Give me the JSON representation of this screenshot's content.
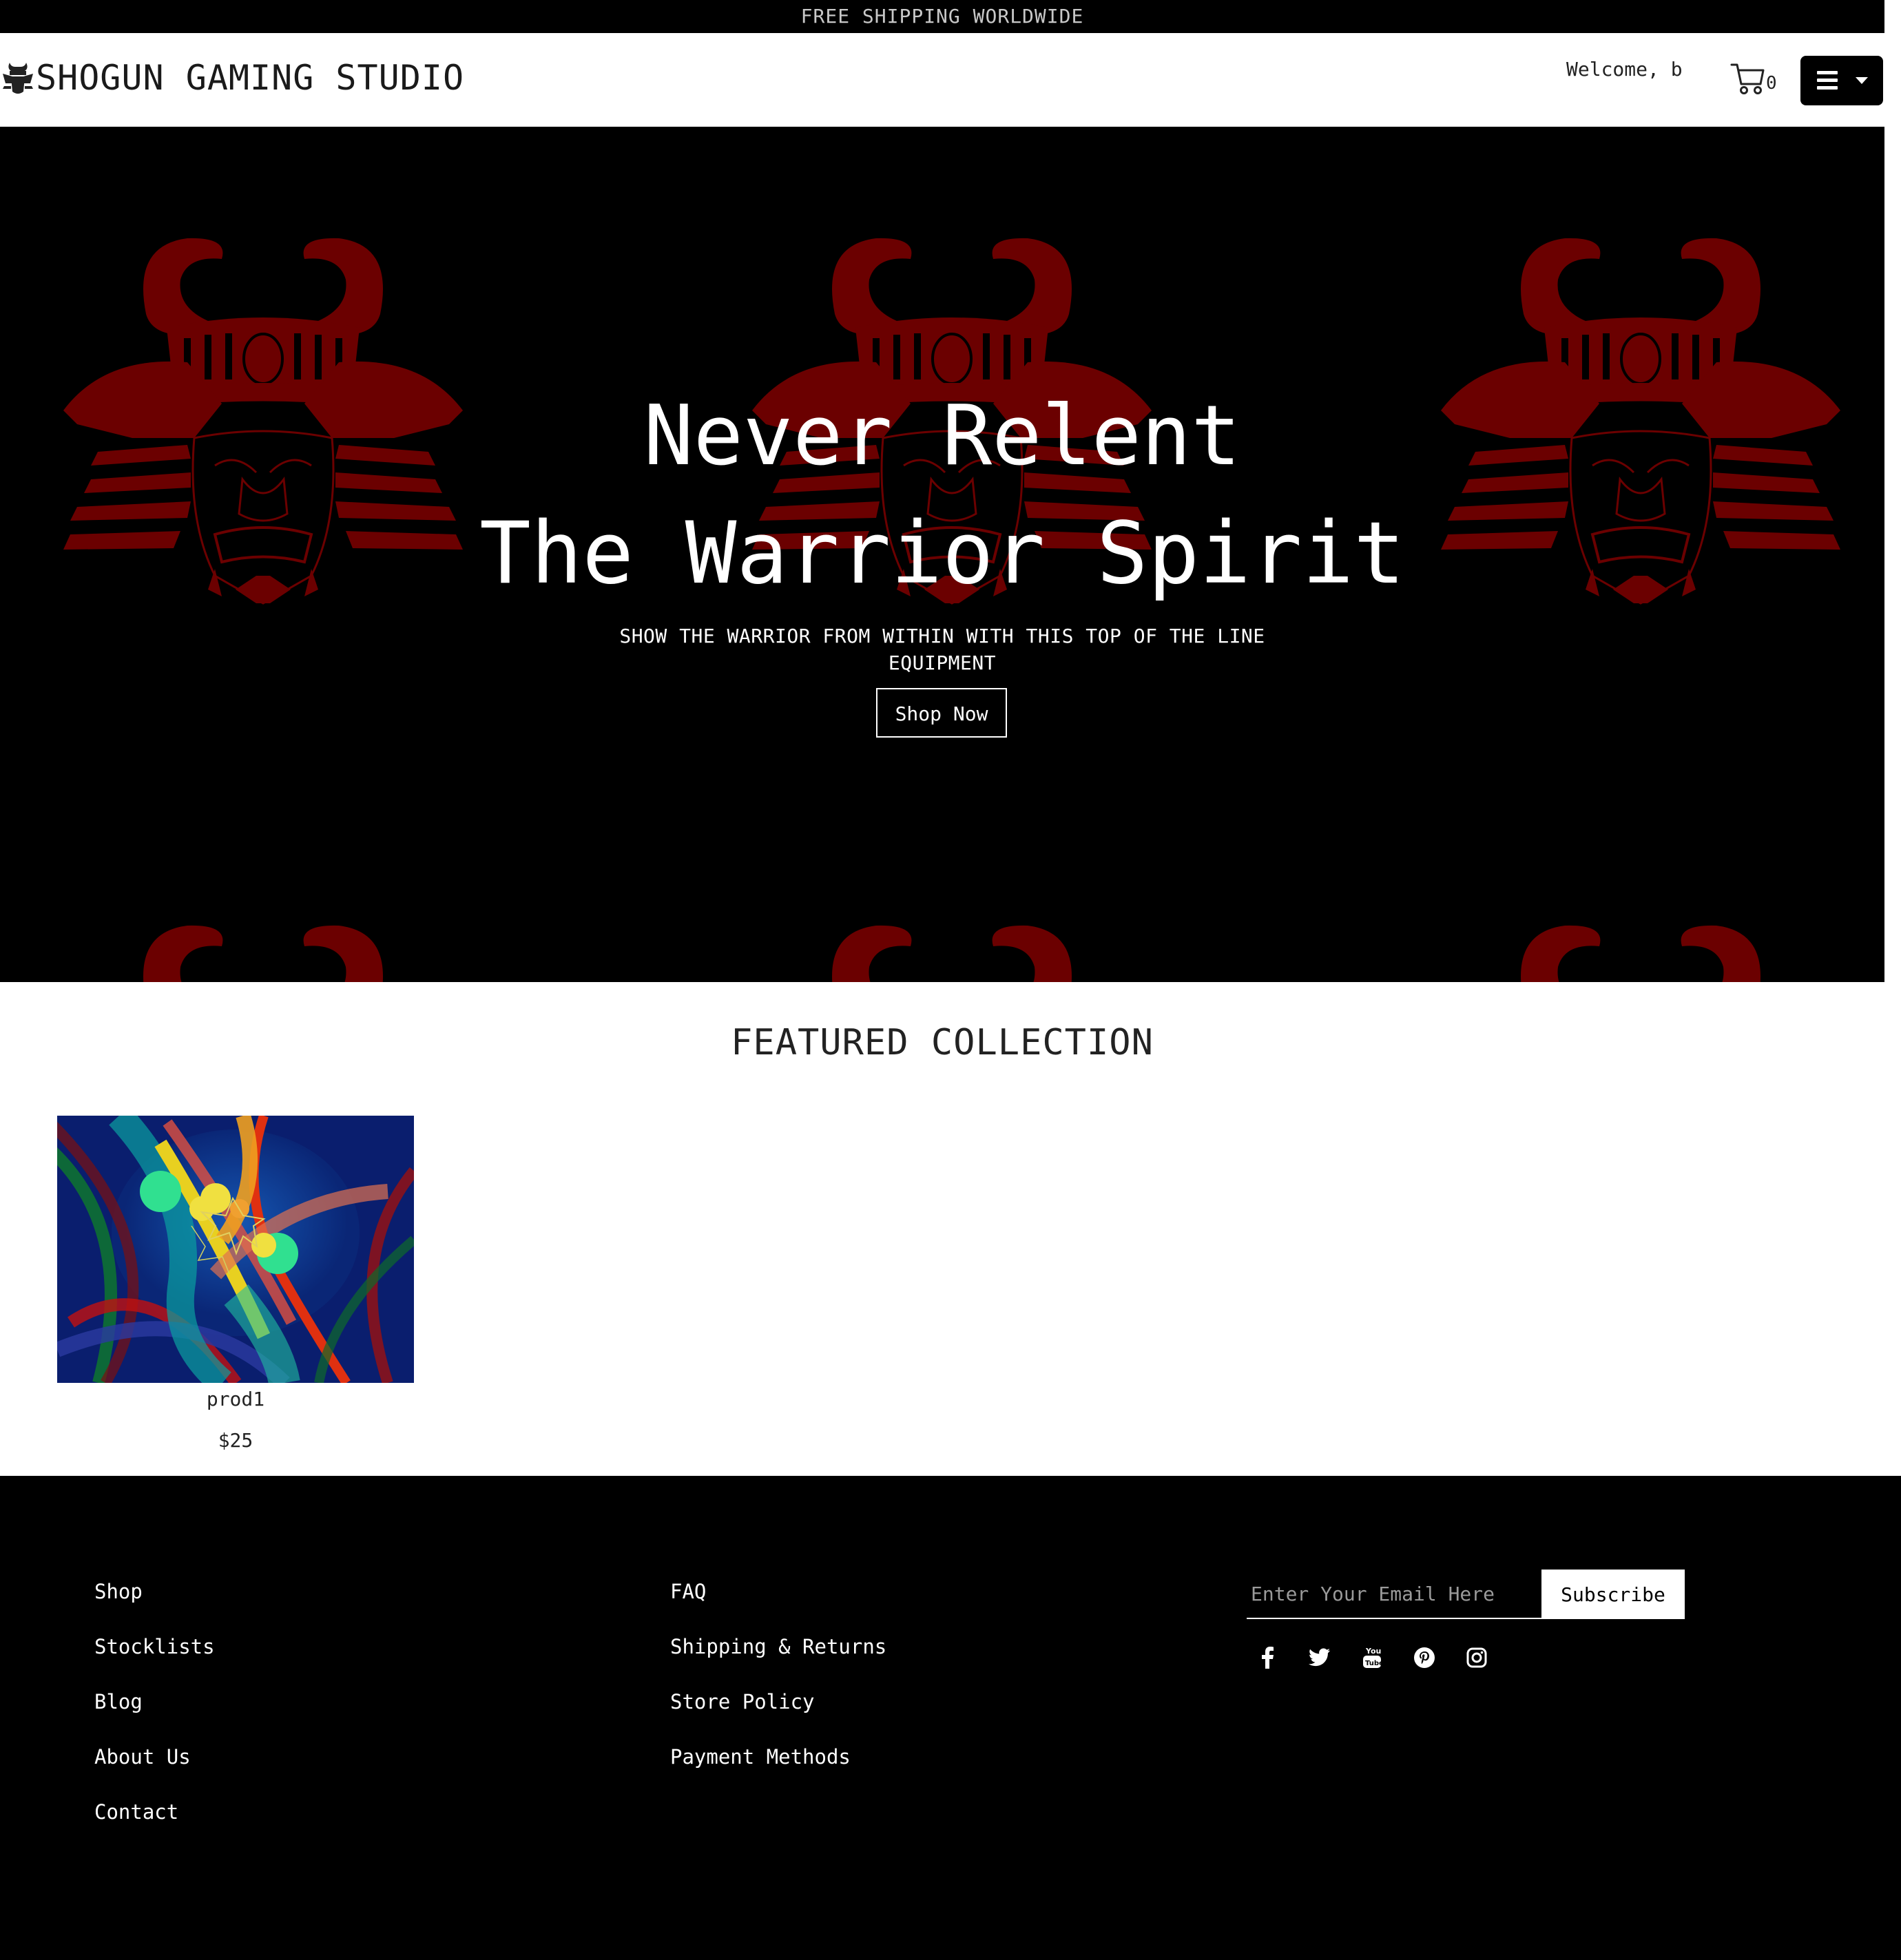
{
  "announcement": "FREE SHIPPING WORLDWIDE",
  "header": {
    "brand_title": "SHOGUN GAMING STUDIO",
    "welcome": "Welcome, b",
    "cart_count": "0"
  },
  "hero": {
    "line1": "Never Relent",
    "line2": "The Warrior Spirit",
    "subtitle": "SHOW THE WARRIOR FROM WITHIN WITH THIS TOP OF THE LINE EQUIPMENT",
    "button": "Shop Now"
  },
  "featured": {
    "title": "FEATURED COLLECTION",
    "products": [
      {
        "name": "prod1",
        "price": "$25"
      }
    ]
  },
  "footer": {
    "col1": [
      "Shop",
      "Stocklists",
      "Blog",
      "About Us",
      "Contact"
    ],
    "col2": [
      "FAQ",
      "Shipping & Returns",
      "Store Policy",
      "Payment Methods"
    ],
    "newsletter": {
      "placeholder": "Enter Your Email Here",
      "button": "Subscribe"
    },
    "social_icons": [
      "facebook-icon",
      "twitter-icon",
      "youtube-icon",
      "pinterest-icon",
      "instagram-icon"
    ]
  },
  "colors": {
    "hero_bg": "#000000",
    "kabuto_red": "#6b0000",
    "footer_bg": "#000000"
  }
}
